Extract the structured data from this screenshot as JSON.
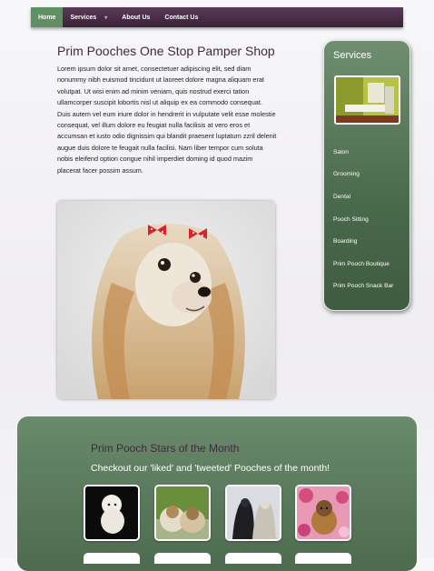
{
  "nav": {
    "items": [
      {
        "label": "Home",
        "active": true
      },
      {
        "label": "Services",
        "has_dropdown": true
      },
      {
        "label": "About Us"
      },
      {
        "label": "Contact Us"
      }
    ]
  },
  "main": {
    "title": "Prim Pooches One Stop Pamper Shop",
    "body": "Lorem ipsum dolor sit amet, consectetuer adipiscing elit, sed diam nonummy nibh euismod tincidunt ut laoreet dolore magna aliquam erat volutpat. Ut wisi enim ad minim veniam, quis nostrud exerci tation ullamcorper suscipit lobortis nisl ut aliquip ex ea commodo consequat. Duis autem vel eum iriure dolor in hendrerit in vulputate velit esse molestie consequat, vel illum dolore eu feugiat nulla facilisis at vero eros et accumsan et iusto odio dignissim qui blandit praesent luptatum zzril delenit augue duis dolore te feugait nulla facilisi. Nam liber tempor cum soluta nobis eleifend option congue nihil imperdiet doming id quod mazim placerat facer possim assum."
  },
  "sidebar": {
    "title": "Services",
    "links": [
      "Salon",
      "Grooming",
      "Dental",
      "Pooch Sitting",
      "Boarding",
      "Prim Pooch Boutique",
      "Prim Pooch Snack Bar"
    ]
  },
  "stars": {
    "title": "Prim Pooch Stars of the Month",
    "subtitle": "Checkout our 'liked' and 'tweeted' Pooches of the month!"
  },
  "colors": {
    "nav_bg": "#3a2238",
    "nav_active": "#5f8f62",
    "green_panel": "#5a7a5c",
    "heading_purple": "#3f2b3e"
  }
}
